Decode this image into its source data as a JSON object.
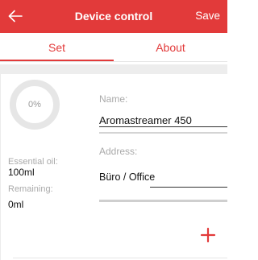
{
  "header": {
    "title": "Device control",
    "save_label": "Save",
    "back_icon": "arrow-left-icon"
  },
  "tabs": [
    {
      "label": "Set",
      "active": true
    },
    {
      "label": "About",
      "active": false
    }
  ],
  "status": {
    "level_text": "0%",
    "level_value": 0,
    "essential_oil_label": "Essential oil:",
    "essential_oil_value": "100ml",
    "remaining_label": "Remaining:",
    "remaining_value": "0ml"
  },
  "form": {
    "name_label": "Name:",
    "name_value": "Aromastreamer 450",
    "address_label": "Address:",
    "address_value": "Büro / Office"
  },
  "add_icon": "plus-icon",
  "colors": {
    "accent": "#e23a3a",
    "gauge_track": "#e6e6e6",
    "label": "#aaaaaa"
  }
}
